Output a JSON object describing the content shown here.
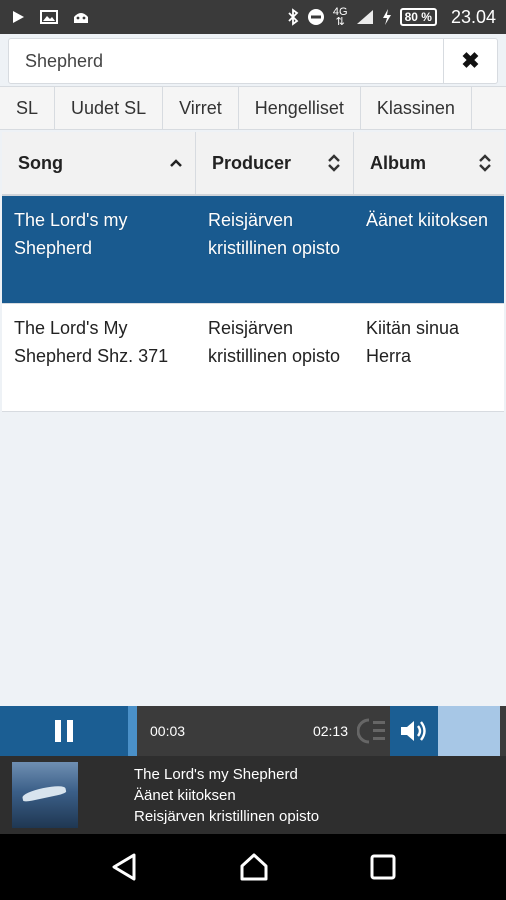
{
  "status": {
    "network": "4G",
    "battery": "80 %",
    "time": "23.04"
  },
  "search": {
    "value": "Shepherd",
    "placeholder": ""
  },
  "tabs": [
    "SL",
    "Uudet SL",
    "Virret",
    "Hengelliset",
    "Klassinen"
  ],
  "table": {
    "headers": [
      "Song",
      "Producer",
      "Album"
    ],
    "rows": [
      [
        "The Lord's my Shepherd",
        "Reisjärven kristillinen opisto",
        "Äänet kiitoksen"
      ],
      [
        "The Lord's My Shepherd Shz. 371",
        "Reisjärven kristillinen opisto",
        "Kiitän sinua Herra"
      ]
    ]
  },
  "player": {
    "current_time": "00:03",
    "total_time": "02:13",
    "progress_fraction": 0.02
  },
  "now_playing": {
    "title": "The Lord's my Shepherd",
    "album": "Äänet kiitoksen",
    "producer": "Reisjärven kristillinen opisto"
  },
  "colors": {
    "accent": "#195a8f",
    "player_bg": "#3b3b3b"
  }
}
